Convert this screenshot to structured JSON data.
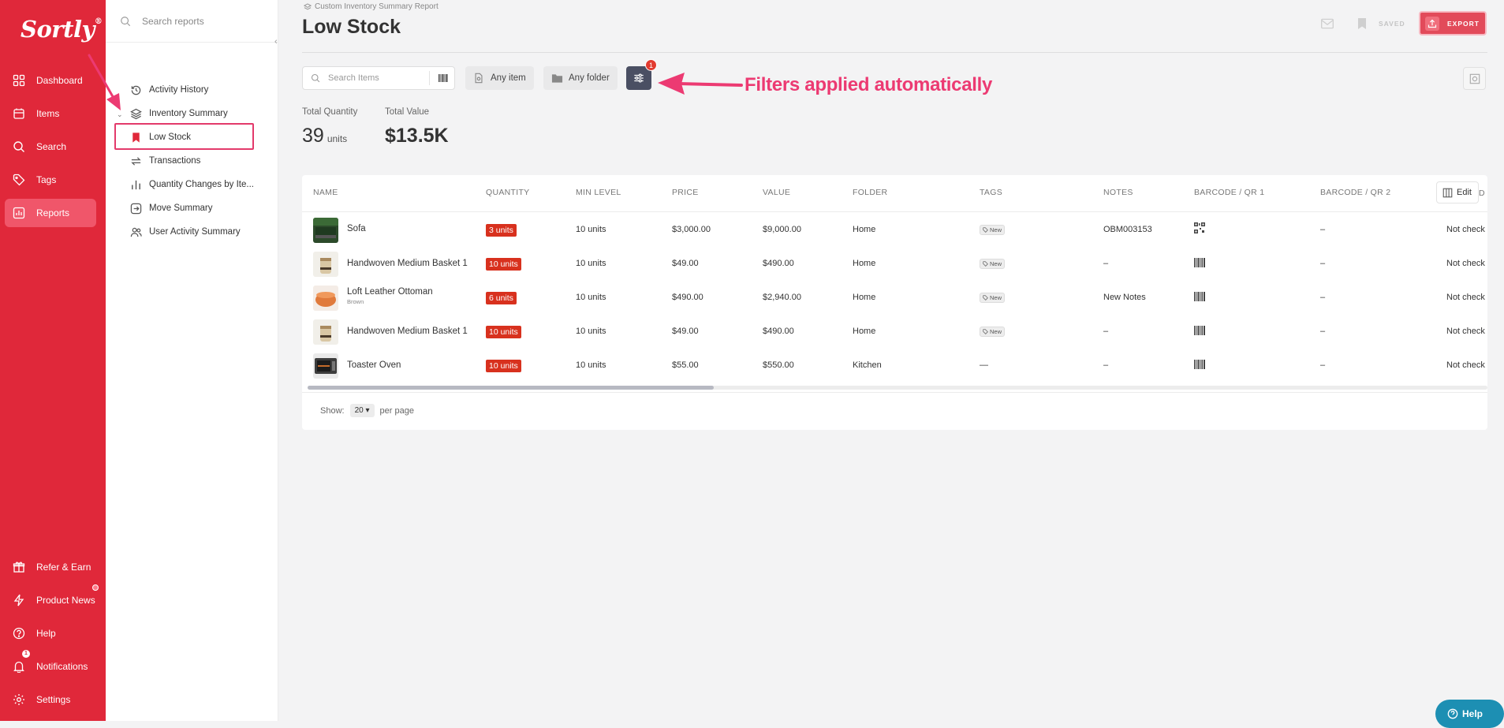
{
  "brand": {
    "logo": "Sortly",
    "registered": "®"
  },
  "nav": {
    "items": [
      {
        "label": "Dashboard"
      },
      {
        "label": "Items"
      },
      {
        "label": "Search"
      },
      {
        "label": "Tags"
      },
      {
        "label": "Reports",
        "active": true
      }
    ],
    "bottom_items": [
      {
        "label": "Refer & Earn"
      },
      {
        "label": "Product News"
      },
      {
        "label": "Help"
      },
      {
        "label": "Notifications",
        "badge": "1"
      },
      {
        "label": "Settings"
      }
    ]
  },
  "reports_sidebar": {
    "search_placeholder": "Search reports",
    "items": [
      {
        "label": "Activity History"
      },
      {
        "label": "Inventory Summary"
      },
      {
        "label": "Low Stock",
        "selected": true
      },
      {
        "label": "Transactions"
      },
      {
        "label": "Quantity Changes by Ite..."
      },
      {
        "label": "Move Summary"
      },
      {
        "label": "User Activity Summary"
      }
    ]
  },
  "header": {
    "breadcrumb": "Custom Inventory Summary Report",
    "title": "Low Stock",
    "saved_label": "SAVED",
    "export_label": "EXPORT"
  },
  "filters": {
    "search_placeholder": "Search Items",
    "item_filter": "Any item",
    "folder_filter": "Any folder",
    "applied_count": "1",
    "annotation": "Filters applied automatically"
  },
  "stats": {
    "total_quantity_label": "Total Quantity",
    "total_quantity_value": "39",
    "total_quantity_unit": "units",
    "total_value_label": "Total Value",
    "total_value_value": "$13.5K"
  },
  "table": {
    "columns": [
      "NAME",
      "QUANTITY",
      "MIN LEVEL",
      "PRICE",
      "VALUE",
      "FOLDER",
      "TAGS",
      "NOTES",
      "BARCODE / QR 1",
      "BARCODE / QR 2"
    ],
    "edit_label": "Edit",
    "cut_column": "D",
    "rows": [
      {
        "name": "Sofa",
        "sub": "",
        "quantity": "3 units",
        "min_level": "10 units",
        "price": "$3,000.00",
        "value": "$9,000.00",
        "folder": "Home",
        "tag": "New",
        "notes": "OBM003153",
        "barcode1": "qr",
        "barcode2": "–",
        "checked": "Not check",
        "thumb": "sofa"
      },
      {
        "name": "Handwoven Medium Basket 1",
        "sub": "",
        "quantity": "10 units",
        "min_level": "10 units",
        "price": "$49.00",
        "value": "$490.00",
        "folder": "Home",
        "tag": "New",
        "notes": "–",
        "barcode1": "barcode",
        "barcode2": "–",
        "checked": "Not check",
        "thumb": "basket"
      },
      {
        "name": "Loft Leather Ottoman",
        "sub": "Brown",
        "quantity": "6 units",
        "min_level": "10 units",
        "price": "$490.00",
        "value": "$2,940.00",
        "folder": "Home",
        "tag": "New",
        "notes": "New Notes",
        "barcode1": "barcode",
        "barcode2": "–",
        "checked": "Not check",
        "thumb": "ottoman"
      },
      {
        "name": "Handwoven Medium Basket 1",
        "sub": "",
        "quantity": "10 units",
        "min_level": "10 units",
        "price": "$49.00",
        "value": "$490.00",
        "folder": "Home",
        "tag": "New",
        "notes": "–",
        "barcode1": "barcode",
        "barcode2": "–",
        "checked": "Not check",
        "thumb": "basket"
      },
      {
        "name": "Toaster Oven",
        "sub": "",
        "quantity": "10 units",
        "min_level": "10 units",
        "price": "$55.00",
        "value": "$550.00",
        "folder": "Kitchen",
        "tag": "",
        "tag_empty": "—",
        "notes": "–",
        "barcode1": "barcode",
        "barcode2": "–",
        "checked": "Not check",
        "thumb": "toaster"
      }
    ],
    "show_label": "Show:",
    "per_page_value": "20",
    "per_page_label": "per page"
  },
  "help_fab": {
    "label": "Help"
  },
  "colors": {
    "brand_red": "#e0283a",
    "qty_badge": "#d8311e",
    "annotation_pink": "#ec3a72",
    "filter_button": "#4a4f63",
    "help_blue": "#1d8fb3"
  }
}
